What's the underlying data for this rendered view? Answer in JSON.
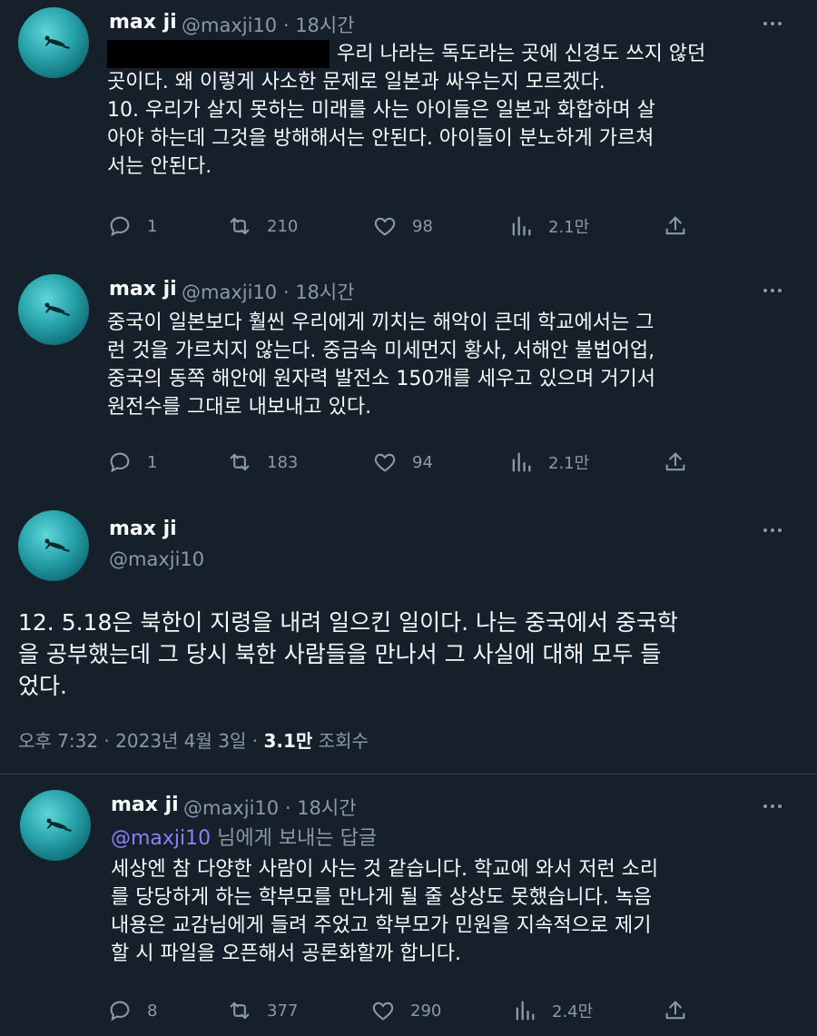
{
  "tweets": [
    {
      "name": "max ji",
      "handle": "@maxji10",
      "time": "· 18시간",
      "first_line": "우리 나라는 독도라는 곳에 신경도 쓰지 않던",
      "text": "곳이다. 왜 이렇게 사소한 문제로 일본과 싸우는지 모르겠다.\n10. 우리가 살지 못하는 미래를 사는 아이들은 일본과 화합하며 살\n아야 하는데 그것을 방해해서는 안된다. 아이들이 분노하게 가르쳐\n서는 안된다.",
      "replies": "1",
      "retweets": "210",
      "likes": "98",
      "views": "2.1만"
    },
    {
      "name": "max ji",
      "handle": "@maxji10",
      "time": "· 18시간",
      "text": "중국이 일본보다 훨씬 우리에게 끼치는 해악이 큰데 학교에서는 그\n런 것을 가르치지 않는다. 중금속 미세먼지 황사, 서해안 불법어업,\n중국의 동쪽 해안에 원자력 발전소 150개를 세우고 있으며 거기서\n원전수를 그대로 내보내고 있다.",
      "replies": "1",
      "retweets": "183",
      "likes": "94",
      "views": "2.1만"
    }
  ],
  "main_tweet": {
    "name": "max ji",
    "handle": "@maxji10",
    "text": "12. 5.18은 북한이 지령을 내려 일으킨 일이다. 나는 중국에서 중국학\n을 공부했는데 그 당시 북한 사람들을 만나서 그 사실에 대해 모두 들\n었다.",
    "timestamp": "오후 7:32 · 2023년 4월 3일 · ",
    "views_count": "3.1만",
    "views_label": " 조회수"
  },
  "reply": {
    "name": "max ji",
    "handle": "@maxji10",
    "time": "· 18시간",
    "mention": "@maxji10",
    "reply_label": " 님에게 보내는 답글",
    "text": "세상엔 참 다양한 사람이 사는 것 같습니다. 학교에 와서 저런 소리\n를 당당하게 하는 학부모를 만나게 될 줄 상상도 못했습니다. 녹음\n내용은 교감님에게 들려 주었고 학부모가 민원을 지속적으로 제기\n할 시 파일을 오픈해서 공론화할까 합니다.",
    "replies": "8",
    "retweets": "377",
    "likes": "290",
    "views": "2.4만"
  },
  "colors": {
    "background": "#15202b",
    "text": "#f7f9f9",
    "secondary": "#8b98a5",
    "mention": "#8b80f9",
    "divider": "#38444d"
  },
  "icons": [
    "reply-icon",
    "retweet-icon",
    "like-icon",
    "views-icon",
    "share-icon",
    "more-icon",
    "avatar"
  ]
}
